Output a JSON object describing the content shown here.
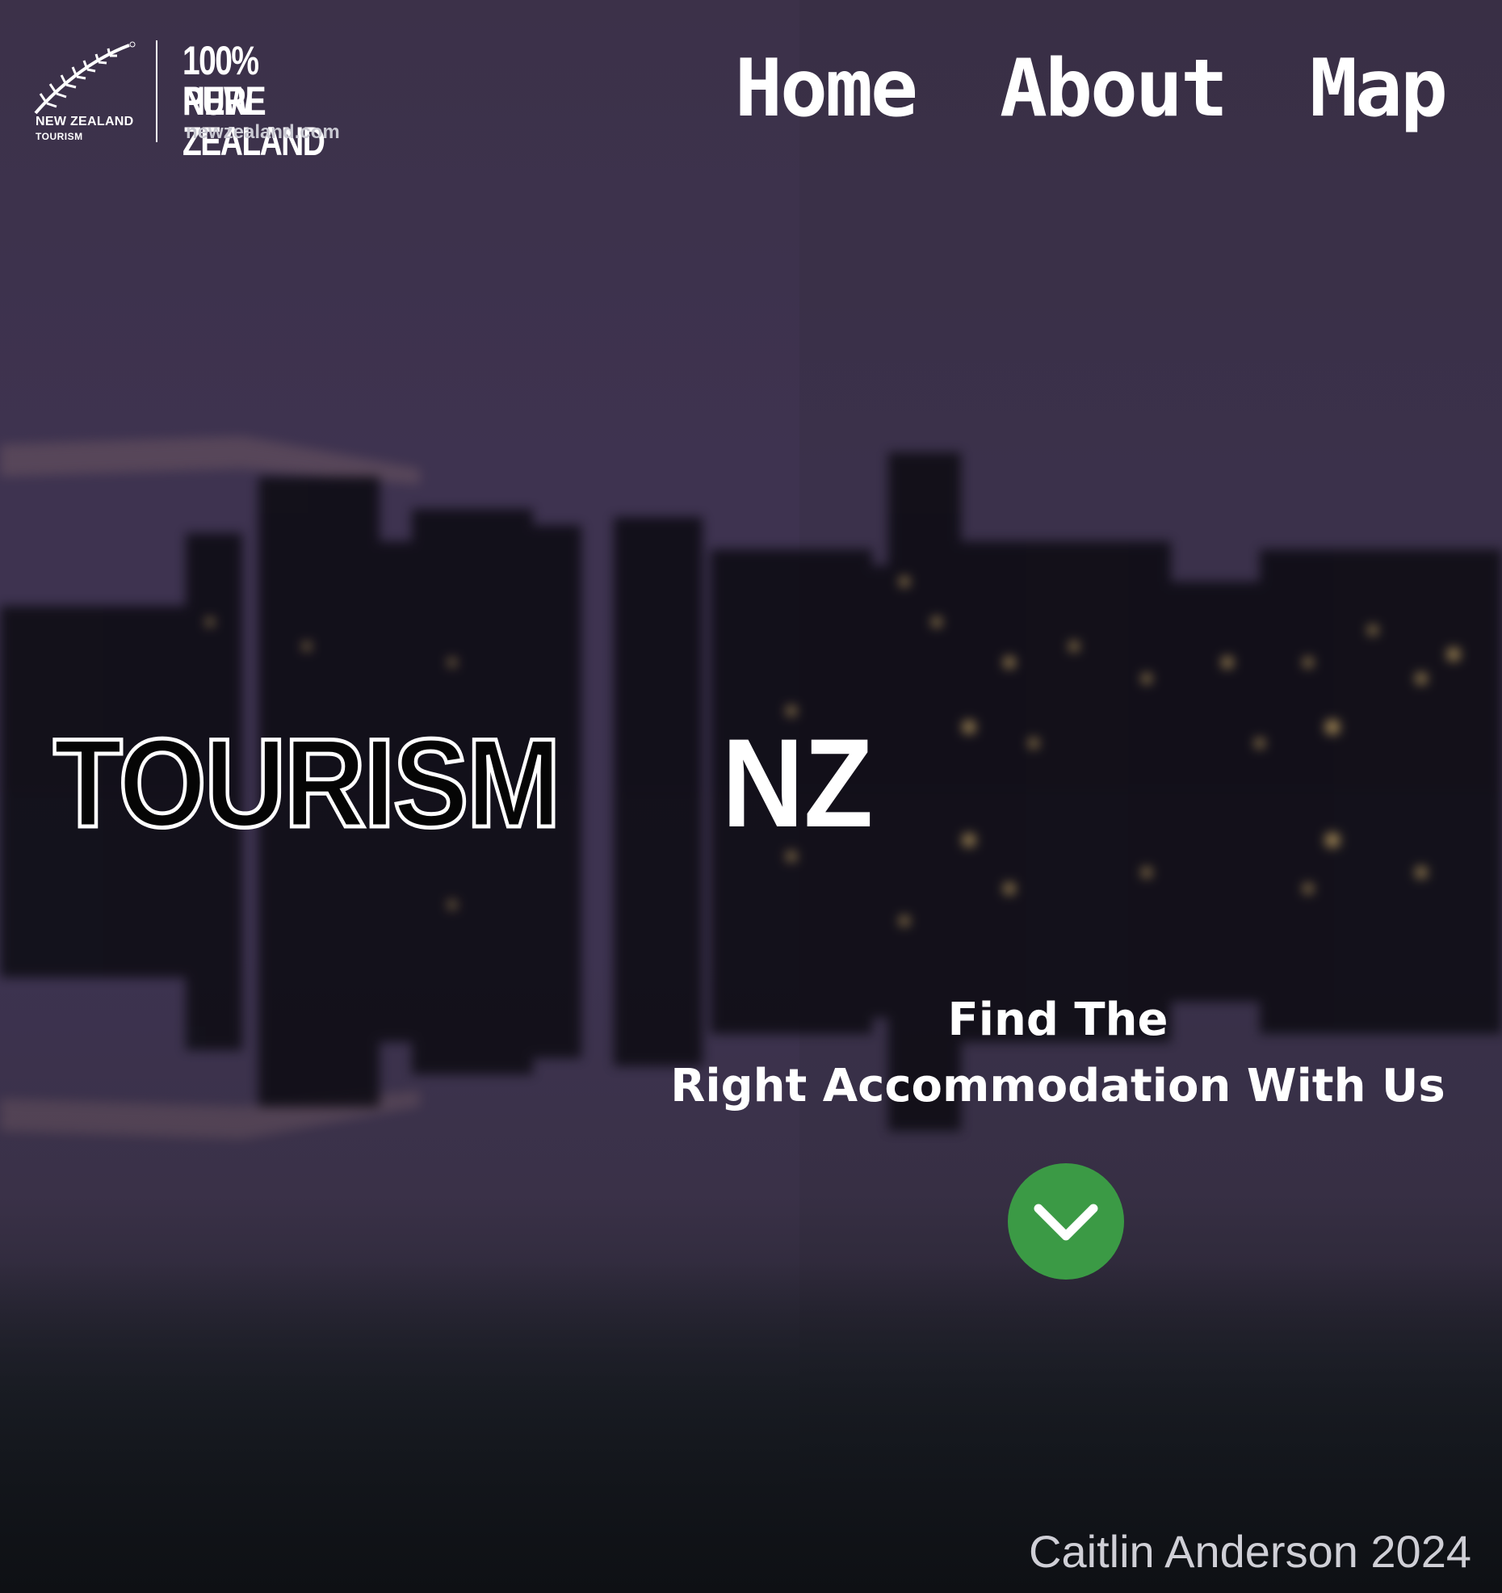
{
  "brand": {
    "logo_text": "NEW ZEALAND",
    "logo_subtext": "TOURISM",
    "tagline_line1": "100% PURE",
    "tagline_line2": "NEW ZEALAND",
    "website": "newzealand.com",
    "fern_icon": "silver-fern-icon"
  },
  "nav": {
    "items": [
      {
        "label": "Home"
      },
      {
        "label": "About"
      },
      {
        "label": "Map"
      }
    ]
  },
  "hero": {
    "title_outline": "TOURISM",
    "title_solid": "NZ",
    "subtitle_line1": "Find The",
    "subtitle_line2": "Right Accommodation With Us",
    "scroll_icon": "chevron-down-icon",
    "scroll_button_color": "#3b9a45"
  },
  "footer": {
    "credit": "Caitlin Anderson 2024"
  },
  "colors": {
    "background": "#3d3350",
    "text": "#ffffff",
    "accent": "#3b9a45"
  }
}
